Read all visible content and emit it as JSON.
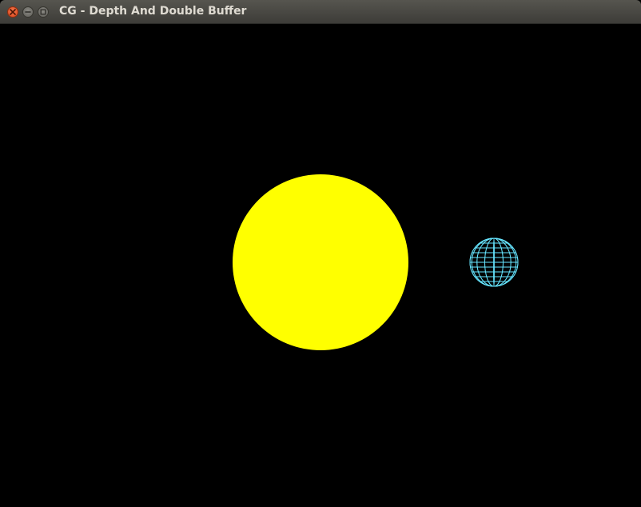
{
  "window": {
    "title": "CG - Depth And Double Buffer"
  },
  "titlebar_buttons": [
    {
      "name": "close",
      "icon": "close-icon"
    },
    {
      "name": "minimize",
      "icon": "minimize-icon"
    },
    {
      "name": "maximize",
      "icon": "maximize-icon"
    }
  ],
  "scene": {
    "background_color": "#000000",
    "sun": {
      "color": "#ffff00",
      "style": "solid"
    },
    "planet": {
      "color": "#66e5ff",
      "style": "wireframe"
    }
  }
}
